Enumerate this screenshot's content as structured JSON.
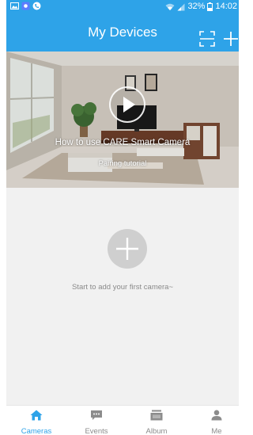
{
  "status_bar": {
    "battery": "32%",
    "time": "14:02",
    "left_icons": [
      "image-icon",
      "app-icon",
      "phone-icon"
    ],
    "right_icons": [
      "wifi-icon",
      "signal-icon",
      "battery-icon"
    ]
  },
  "header": {
    "title": "My Devices",
    "actions": [
      "scan-icon",
      "plus-icon"
    ]
  },
  "banner": {
    "title": "How to use CARE Smart Camera",
    "subtitle": "Pairing tutorial"
  },
  "empty_state": {
    "text": "Start to add your first camera~"
  },
  "bottom_nav": {
    "items": [
      {
        "label": "Cameras",
        "icon": "home-icon",
        "active": true
      },
      {
        "label": "Events",
        "icon": "message-icon",
        "active": false
      },
      {
        "label": "Album",
        "icon": "album-icon",
        "active": false
      },
      {
        "label": "Me",
        "icon": "person-icon",
        "active": false
      }
    ]
  },
  "colors": {
    "primary": "#2ea3e8",
    "background": "#f1f1f1",
    "inactive": "#8c8c8c",
    "empty_button": "#cfcfcf"
  }
}
